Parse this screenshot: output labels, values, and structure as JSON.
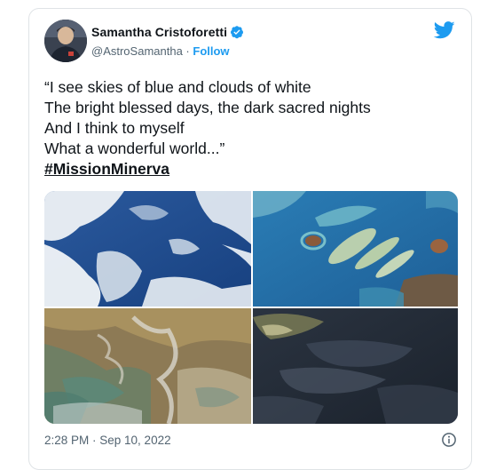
{
  "author": {
    "display_name": "Samantha Cristoforetti",
    "handle": "@AstroSamantha",
    "separator": " · ",
    "follow_label": "Follow",
    "avatar_icon": "astronaut-avatar",
    "verified_icon": "verified-badge-icon"
  },
  "tweet": {
    "lines": [
      "“I see skies of blue and clouds of white",
      "The bright blessed days, the dark sacred nights",
      "And I think to myself",
      "What a wonderful world...”"
    ],
    "hashtag": "#MissionMinerva"
  },
  "photos": [
    {
      "name": "clouds over ocean"
    },
    {
      "name": "turquoise islands"
    },
    {
      "name": "desert terrain"
    },
    {
      "name": "dark ocean with sunglint"
    }
  ],
  "footer": {
    "timestamp": "2:28 PM · Sep 10, 2022",
    "info_icon": "info-icon"
  },
  "colors": {
    "brand": "#1d9bf0",
    "text": "#0f1419",
    "secondary": "#536471",
    "border": "#dfe3e6"
  }
}
